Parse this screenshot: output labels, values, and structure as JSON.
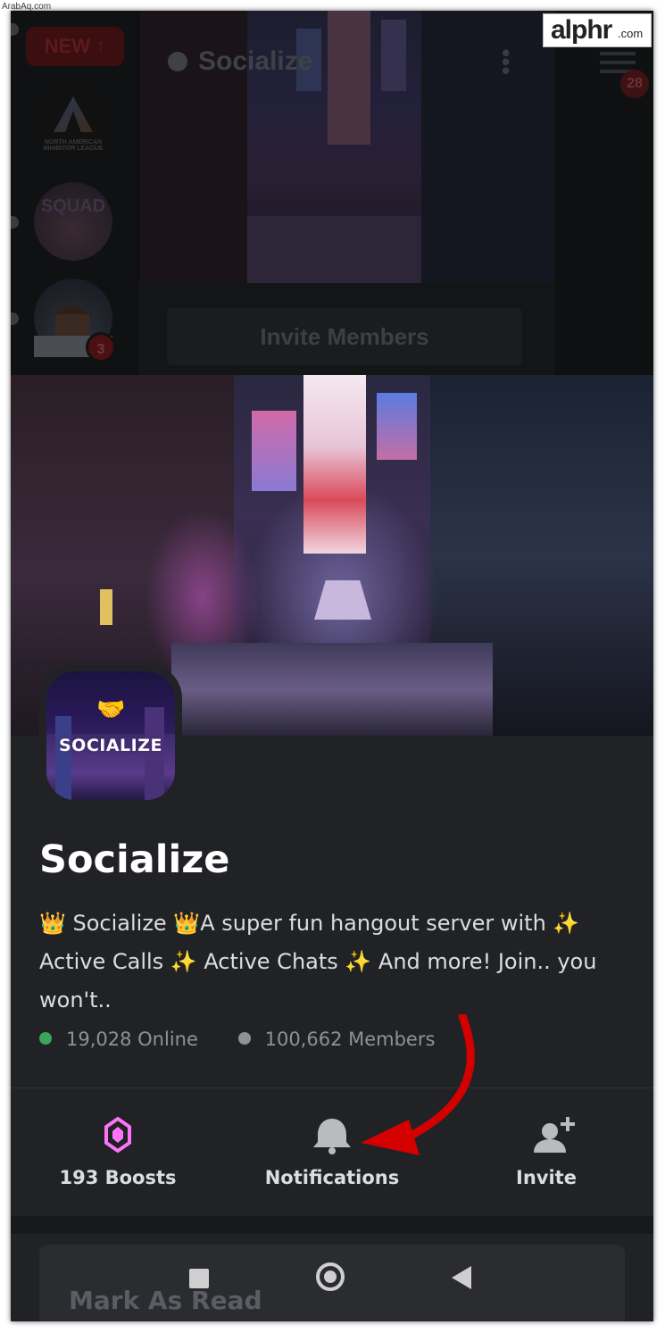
{
  "watermark": {
    "site_tag": "ArabAq.com"
  },
  "brand": {
    "name": "alphr",
    "tld": ".com"
  },
  "background_app": {
    "new_button": "NEW",
    "server_list": [
      {
        "name": "North American Inhibitor League",
        "icon_text": "NORTH AMERICAN INHIBITOR LEAGUE"
      },
      {
        "name": "Squad",
        "icon_text": "SQUAD"
      },
      {
        "name": "Cabin server",
        "badge": "3"
      }
    ],
    "title": "Socialize",
    "unread_badge": "28",
    "invite_button": "Invite Members"
  },
  "server": {
    "icon_text": "SOCIALIZE",
    "name": "Socialize",
    "description": "👑 Socialize 👑A super fun hangout server with ✨ Active Calls ✨ Active Chats ✨ And more! Join.. you won't..",
    "online": "19,028 Online",
    "members": "100,662 Members"
  },
  "actions": {
    "boosts": "193 Boosts",
    "notifications": "Notifications",
    "invite": "Invite"
  },
  "lower": {
    "mark_as_read": "Mark As Read"
  },
  "colors": {
    "sheet_bg": "#202226",
    "online_dot": "#3ba55c",
    "boost_icon": "#ff73fa",
    "annotation_arrow": "#d40000"
  }
}
